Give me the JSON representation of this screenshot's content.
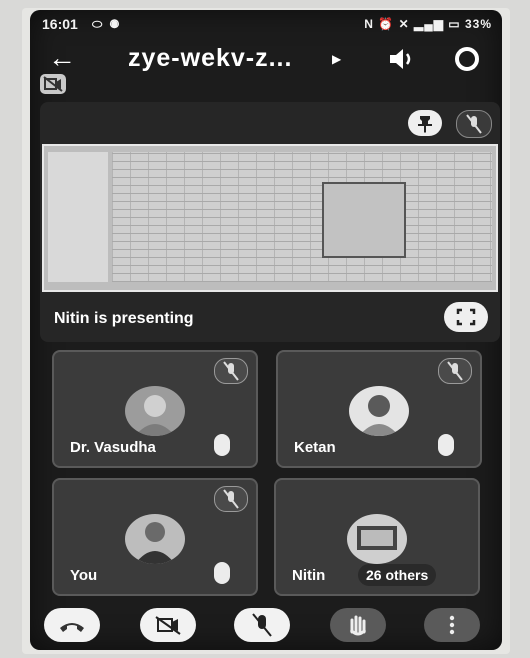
{
  "status_bar": {
    "time": "16:01",
    "left_icons": [
      "messenger-icon",
      "whatsapp-icon"
    ],
    "right_icons": [
      "nfc-icon",
      "alarm-icon",
      "mute-icon",
      "signal-icon",
      "battery-icon"
    ],
    "battery": "33%"
  },
  "header": {
    "meeting_code": "zye-wekv-z...",
    "icons": [
      "back-arrow-icon",
      "speaker-icon",
      "switch-camera-icon"
    ]
  },
  "presentation": {
    "presenting_label": "Nitin is presenting",
    "icons": [
      "pin-icon",
      "mic-off-icon",
      "fullscreen-icon"
    ]
  },
  "participants": [
    {
      "name": "Dr. Vasudha",
      "muted": true
    },
    {
      "name": "Ketan",
      "muted": true
    },
    {
      "name": "You",
      "muted": true
    },
    {
      "name": "Nitin",
      "muted": false,
      "others": "26 others"
    }
  ],
  "controls": [
    {
      "name": "end-call",
      "icon": "phone-hangup-icon",
      "color": "#f2f2f2"
    },
    {
      "name": "camera-off",
      "icon": "camera-off-icon",
      "color": "#f2f2f2"
    },
    {
      "name": "mic-off",
      "icon": "mic-off-icon",
      "color": "#f2f2f2"
    },
    {
      "name": "raise-hand",
      "icon": "hand-icon",
      "color": "#5a5a5a"
    },
    {
      "name": "more-options",
      "icon": "more-vertical-icon",
      "color": "#5a5a5a"
    }
  ]
}
